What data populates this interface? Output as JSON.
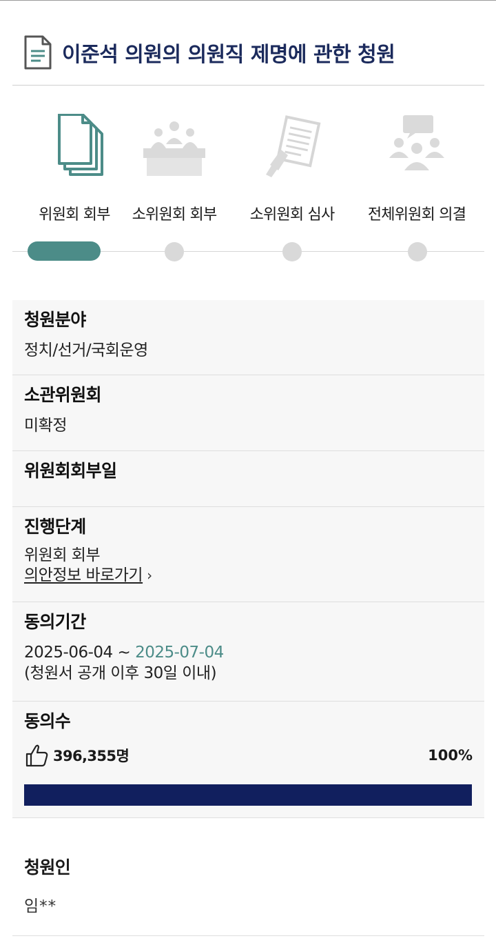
{
  "page": {
    "title": "이준석 의원의 의원직 제명에 관한 청원"
  },
  "steps": [
    {
      "label": "위원회 회부",
      "icon": "documents-icon",
      "active": true
    },
    {
      "label": "소위원회 회부",
      "icon": "meeting-icon",
      "active": false
    },
    {
      "label": "소위원회 심사",
      "icon": "review-document-icon",
      "active": false
    },
    {
      "label": "전체위원회 의결",
      "icon": "group-discussion-icon",
      "active": false
    }
  ],
  "info": {
    "field": {
      "label": "청원분야",
      "value": "정치/선거/국회운영"
    },
    "committee": {
      "label": "소관위원회",
      "value": "미확정"
    },
    "referral_date": {
      "label": "위원회회부일",
      "value": ""
    },
    "stage": {
      "label": "진행단계",
      "value": "위원회 회부",
      "link": "의안정보 바로가기"
    },
    "period": {
      "label": "동의기간",
      "start": "2025-06-04",
      "separator": " ~ ",
      "end": "2025-07-04",
      "note": "(청원서 공개 이후 30일 이내)"
    },
    "votes": {
      "label": "동의수",
      "count": "396,355명",
      "percent": "100%",
      "progress": 1.0
    }
  },
  "petitioner": {
    "label": "청원인",
    "value": "임**"
  },
  "colors": {
    "accent": "#4c8c88",
    "navy": "#111f5e",
    "title": "#1b2a5c",
    "inactive": "#d9d9d9"
  }
}
